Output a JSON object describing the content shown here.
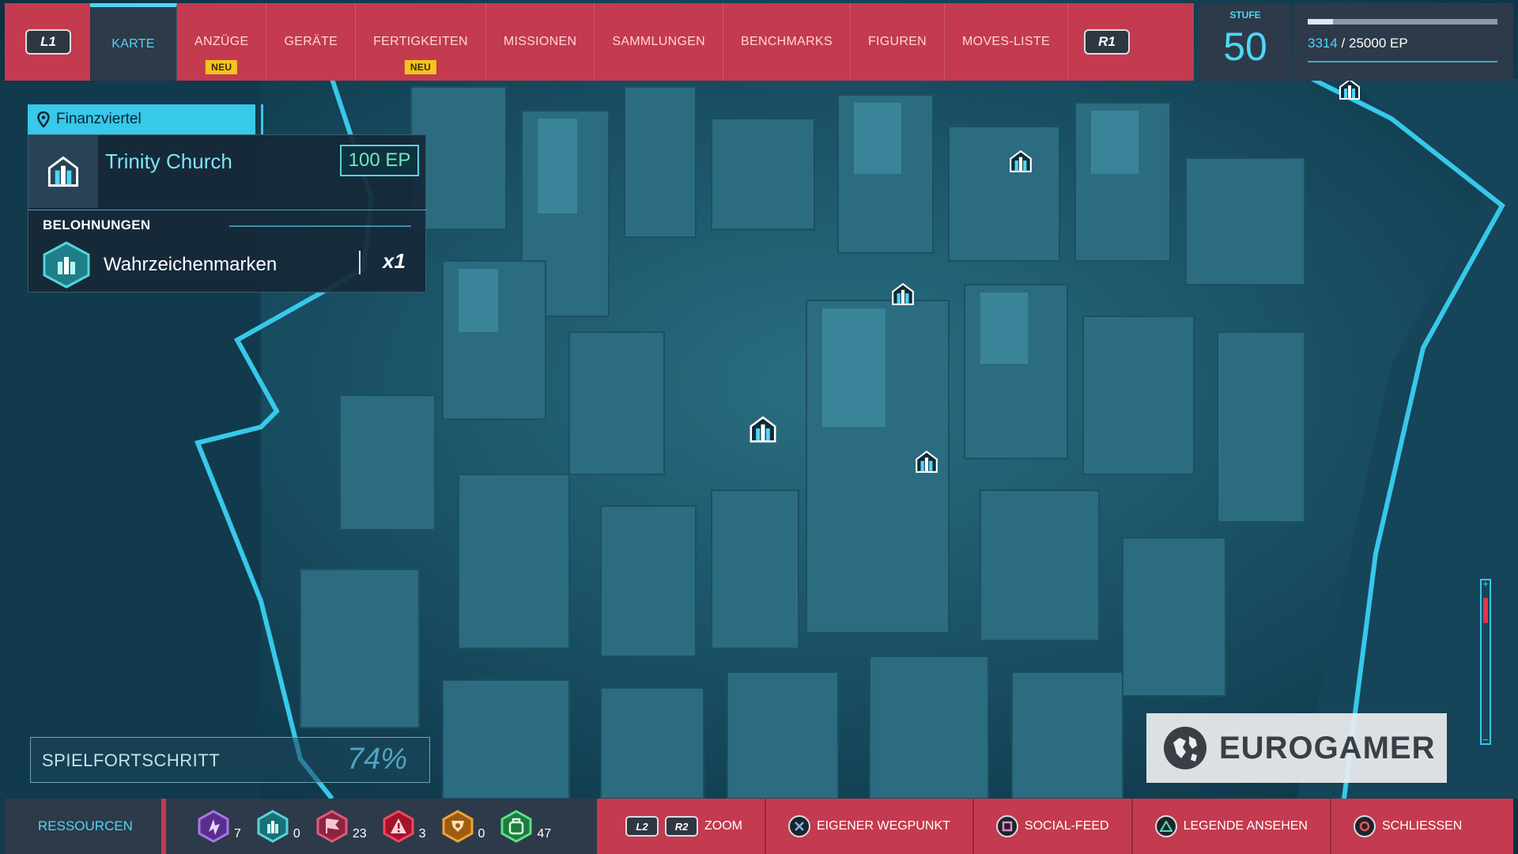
{
  "nav": {
    "l1": "L1",
    "r1": "R1",
    "tabs": [
      {
        "label": "KARTE",
        "active": true,
        "badge": ""
      },
      {
        "label": "ANZÜGE",
        "active": false,
        "badge": "NEU"
      },
      {
        "label": "GERÄTE",
        "active": false,
        "badge": ""
      },
      {
        "label": "FERTIGKEITEN",
        "active": false,
        "badge": "NEU"
      },
      {
        "label": "MISSIONEN",
        "active": false,
        "badge": ""
      },
      {
        "label": "SAMMLUNGEN",
        "active": false,
        "badge": ""
      },
      {
        "label": "BENCHMARKS",
        "active": false,
        "badge": ""
      },
      {
        "label": "FIGUREN",
        "active": false,
        "badge": ""
      },
      {
        "label": "MOVES-LISTE",
        "active": false,
        "badge": ""
      }
    ]
  },
  "level": {
    "label": "STUFE",
    "value": "50"
  },
  "xp": {
    "current": "3314",
    "separator": " / ",
    "total": "25000 EP",
    "fraction": 0.1326
  },
  "location": {
    "district": "Finanzviertel",
    "icon": "map-pin-icon"
  },
  "landmark": {
    "name": "Trinity Church",
    "reward_ep": "100 EP",
    "icon": "landmark-icon",
    "rewards_label": "BELOHNUNGEN",
    "reward_name": "Wahrzeichenmarken",
    "reward_qty": "x1"
  },
  "progress": {
    "label": "SPIELFORTSCHRITT",
    "value": "74%"
  },
  "resources": {
    "label": "RESSOURCEN",
    "items": [
      {
        "icon": "benchmark-token-icon",
        "count": "7",
        "color": "#8a4fd0"
      },
      {
        "icon": "landmark-token-icon",
        "count": "0",
        "color": "#2fb2b6"
      },
      {
        "icon": "crime-token-icon",
        "count": "23",
        "color": "#c23a55"
      },
      {
        "icon": "base-token-icon",
        "count": "3",
        "color": "#d6243a"
      },
      {
        "icon": "challenge-token-icon",
        "count": "0",
        "color": "#e08a1c"
      },
      {
        "icon": "research-token-icon",
        "count": "47",
        "color": "#3cc36b"
      }
    ]
  },
  "actions": {
    "l2": "L2",
    "r2": "R2",
    "zoom": "ZOOM",
    "waypoint": "EIGENER WEGPUNKT",
    "social": "SOCIAL-FEED",
    "legend": "LEGENDE ANSEHEN",
    "close": "SCHLIESSEN"
  },
  "watermark": {
    "name": "EUROGAMER"
  },
  "colors": {
    "accent": "#4fd6f5",
    "nav_red": "#c43a4f",
    "panel": "#2d3a49",
    "badge": "#f4c51c"
  }
}
